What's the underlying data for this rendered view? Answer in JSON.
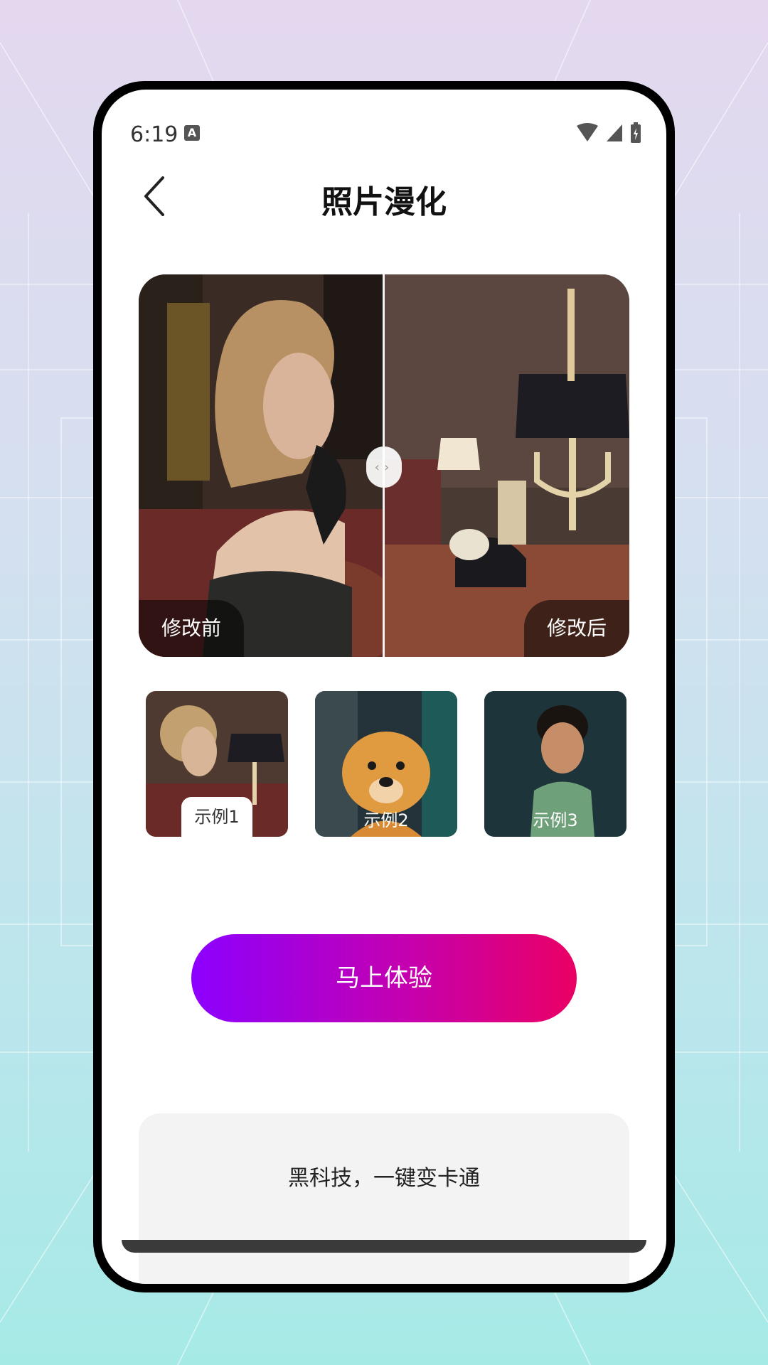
{
  "status_bar": {
    "time": "6:19",
    "notification_icon": "A"
  },
  "header": {
    "title": "照片漫化",
    "back_icon": "chevron-left-icon"
  },
  "compare": {
    "before_label": "修改前",
    "after_label": "修改后",
    "handle_icon": "left-right-arrows-icon"
  },
  "samples": [
    {
      "label": "示例1",
      "selected": true
    },
    {
      "label": "示例2",
      "selected": false
    },
    {
      "label": "示例3",
      "selected": false
    }
  ],
  "cta": {
    "label": "马上体验"
  },
  "feature_card": {
    "text": "黑科技，一键变卡通"
  },
  "colors": {
    "cta_start": "#8c00ff",
    "cta_end": "#ea0064"
  }
}
